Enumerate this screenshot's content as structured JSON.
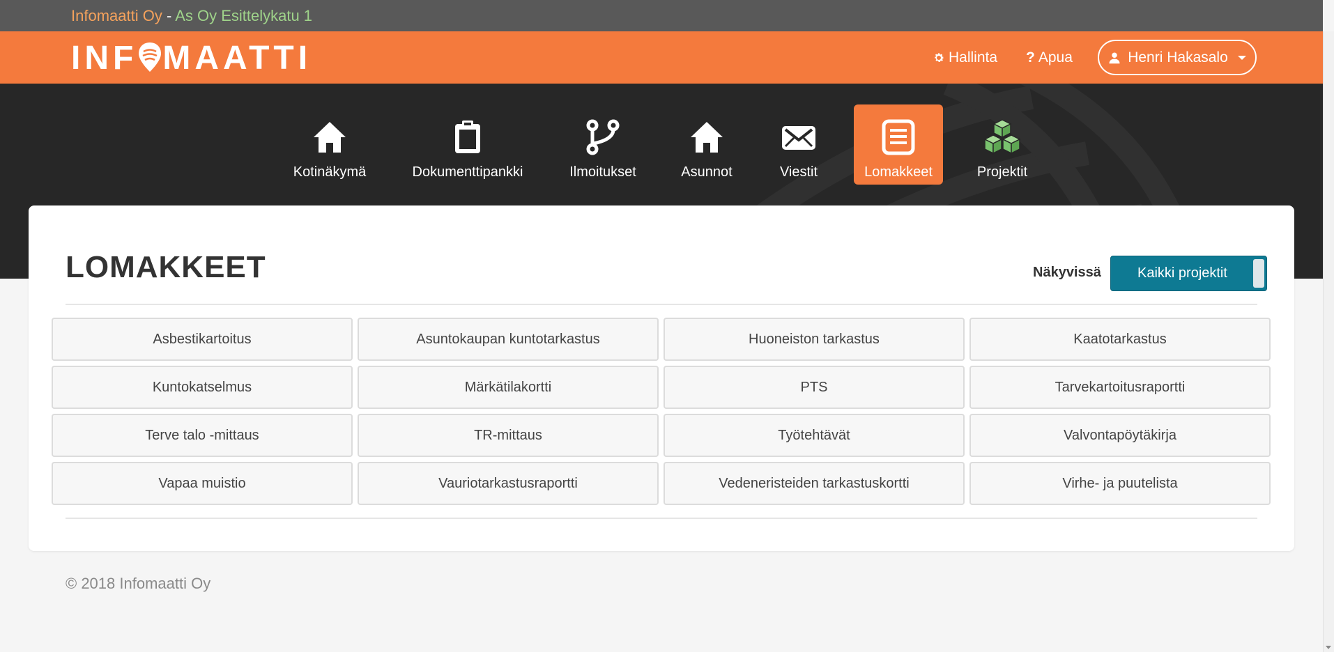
{
  "topbar": {
    "company": "Infomaatti Oy",
    "separator": " - ",
    "housing": "As Oy Esittelykatu 1"
  },
  "header": {
    "logo_left": "INF",
    "logo_right": "MAATTI",
    "settings_label": "Hallinta",
    "help_label": "Apua",
    "user_label": "Henri Hakasalo"
  },
  "nav": [
    {
      "label": "Kotinäkymä",
      "icon": "home-icon"
    },
    {
      "label": "Dokumenttipankki",
      "icon": "clipboard-icon"
    },
    {
      "label": "Ilmoitukset",
      "icon": "branch-icon"
    },
    {
      "label": "Asunnot",
      "icon": "home-icon"
    },
    {
      "label": "Viestit",
      "icon": "envelope-icon"
    },
    {
      "label": "Lomakkeet",
      "icon": "form-list-icon",
      "active": true
    },
    {
      "label": "Projektit",
      "icon": "cubes-icon"
    }
  ],
  "main": {
    "title": "LOMAKKEET",
    "visibility_label": "Näkyvissä",
    "filter_label": "Kaikki projektit",
    "forms": [
      "Asbestikartoitus",
      "Asuntokaupan kuntotarkastus",
      "Huoneiston tarkastus",
      "Kaatotarkastus",
      "Kuntokatselmus",
      "Märkätilakortti",
      "PTS",
      "Tarvekartoitusraportti",
      "Terve talo -mittaus",
      "TR-mittaus",
      "Työtehtävät",
      "Valvontapöytäkirja",
      "Vapaa muistio",
      "Vauriotarkastusraportti",
      "Vedeneristeiden tarkastuskortti",
      "Virhe- ja puutelista"
    ]
  },
  "footer": {
    "copyright": "© 2018 Infomaatti Oy"
  },
  "colors": {
    "brand_orange": "#f47a3d",
    "filter_teal": "#0e7a93",
    "projects_green": "#79c26e"
  }
}
